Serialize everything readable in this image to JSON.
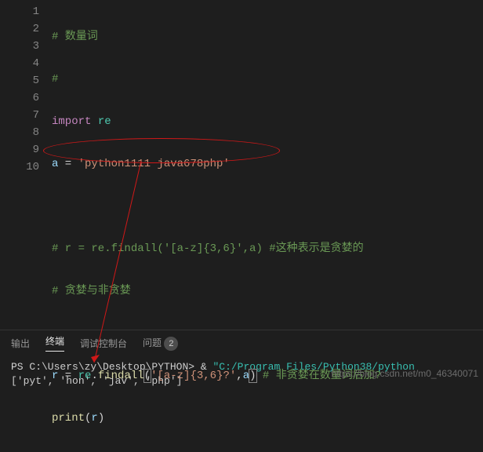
{
  "gutter": [
    "1",
    "2",
    "3",
    "4",
    "5",
    "6",
    "7",
    "8",
    "9",
    "10"
  ],
  "code": {
    "l1": "# 数量词",
    "l2": "#",
    "l3_kw": "import",
    "l3_mod": " re",
    "l4_var": "a",
    "l4_eq": " = ",
    "l4_str": "'python1111 java678php'",
    "l6": "# r = re.findall('[a-z]{3,6}',a) #这种表示是贪婪的",
    "l7": "# 贪婪与非贪婪",
    "l9_var": "r",
    "l9_eq": " = ",
    "l9_re": "re",
    "l9_dot": ".",
    "l9_fn": "findall",
    "l9_p1": "(",
    "l9_arg1": "'[a-z]{3,6}?'",
    "l9_c": ",",
    "l9_arg2": "a",
    "l9_p2": ")",
    "l9_cm": " # 非贪婪在数量词后加?",
    "l10_fn": "print",
    "l10_p1": "(",
    "l10_arg": "r",
    "l10_p2": ")"
  },
  "tabs": {
    "output": "输出",
    "terminal": "终端",
    "debug": "调试控制台",
    "problems": "问题",
    "badge": "2"
  },
  "terminal": {
    "prompt": "PS ",
    "cwd": "C:\\Users\\zy\\Desktop\\PYTHON",
    "gt": "> ",
    "amp": "& ",
    "cmd": "\"C:/Program Files/Python38/python",
    "result": "['pyt', 'hon', 'jav', 'php']"
  },
  "watermark": "https://blog.csdn.net/m0_46340071"
}
